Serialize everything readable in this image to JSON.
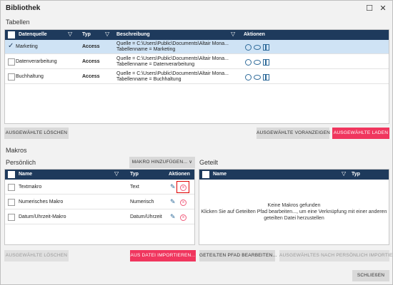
{
  "window": {
    "title": "Bibliothek",
    "maximize_glyph": "☐",
    "close_glyph": "✕"
  },
  "tables_section": {
    "label": "Tabellen",
    "headers": {
      "datasource": "Datenquelle",
      "type": "Typ",
      "description": "Beschreibung",
      "actions": "Aktionen"
    },
    "rows": [
      {
        "name": "Marketing",
        "type": "Access",
        "desc1": "Quelle = C:\\Users\\Public\\Documents\\Altair Mona...",
        "desc2": "Tabellenname = Marketing",
        "selected": true
      },
      {
        "name": "Datenverarbeitung",
        "type": "Access",
        "desc1": "Quelle = C:\\Users\\Public\\Documents\\Altair Mona...",
        "desc2": "Tabellenname = Datenverarbeitung",
        "selected": false
      },
      {
        "name": "Buchhaltung",
        "type": "Access",
        "desc1": "Quelle = C:\\Users\\Public\\Documents\\Altair Mona...",
        "desc2": "Tabellenname = Buchhaltung",
        "selected": false
      }
    ],
    "buttons": {
      "delete_selected": "AUSGEWÄHLTE LÖSCHEN",
      "preview_selected": "AUSGEWÄHLTE VORANZEIGEN",
      "load_selected": "AUSGEWÄHLTE LADEN"
    }
  },
  "macros_section": {
    "label": "Makros",
    "personal": {
      "label": "Persönlich",
      "add_macro": "MAKRO HINZUFÜGEN...",
      "headers": {
        "name": "Name",
        "type": "Typ",
        "actions": "Aktionen"
      },
      "rows": [
        {
          "name": "Textmakro",
          "type": "Text"
        },
        {
          "name": "Numerisches Makro",
          "type": "Numerisch"
        },
        {
          "name": "Datum/Uhrzeit-Makro",
          "type": "Datum/Uhrzeit"
        }
      ],
      "buttons": {
        "delete_selected": "AUSGEWÄHLTE LÖSCHEN",
        "import_file": "AUS DATEI IMPORTIEREN..."
      }
    },
    "shared": {
      "label": "Geteilt",
      "headers": {
        "name": "Name",
        "type": "Typ"
      },
      "empty_line1": "Keine Makros gefunden",
      "empty_line2": "Klicken Sie auf Geteilten Pfad bearbeiten..., um eine Verknüpfung mit einer anderen",
      "empty_line3": "geteilten Datei herzustellen",
      "buttons": {
        "edit_shared_path": "GETEILTEN PFAD BEARBEITEN...",
        "import_to_personal": "AUSGEWÄHLTES NACH PERSÖNLICH IMPORTIEREN"
      }
    }
  },
  "footer": {
    "close": "SCHLIEßEN"
  },
  "colors": {
    "header_bg": "#1e3a5c",
    "accent_red": "#f0365e",
    "selection": "#cfe3f5",
    "icon_blue": "#2f6b9a"
  }
}
